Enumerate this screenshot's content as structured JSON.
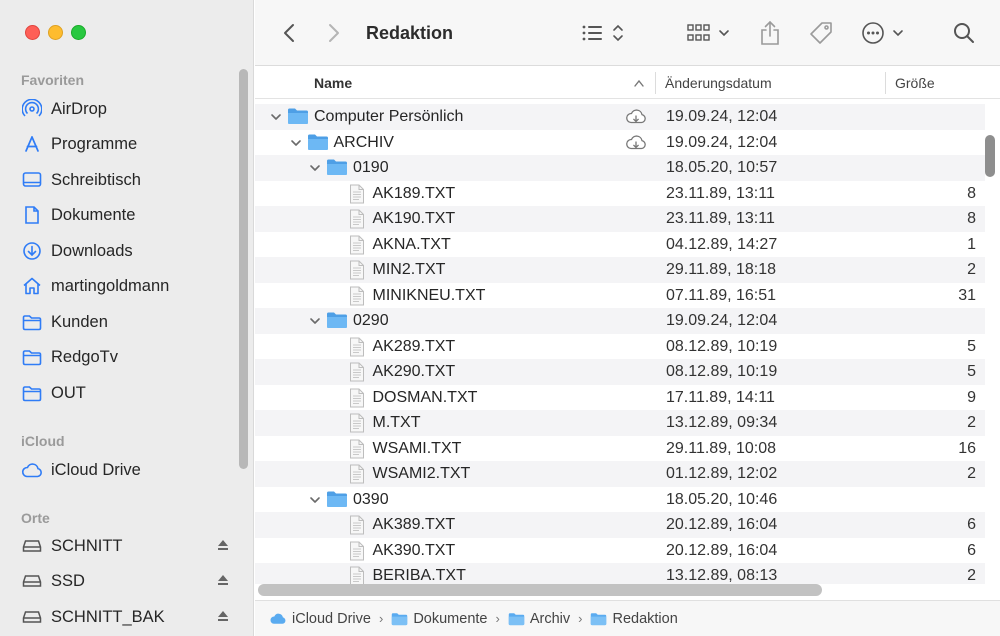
{
  "sidebar": {
    "sections": [
      {
        "label": "Favoriten",
        "items": [
          {
            "label": "AirDrop",
            "icon": "airdrop-icon"
          },
          {
            "label": "Programme",
            "icon": "applications-icon"
          },
          {
            "label": "Schreibtisch",
            "icon": "desktop-icon"
          },
          {
            "label": "Dokumente",
            "icon": "document-icon"
          },
          {
            "label": "Downloads",
            "icon": "downloads-icon"
          },
          {
            "label": "martingoldmann",
            "icon": "home-icon"
          },
          {
            "label": "Kunden",
            "icon": "folder-icon"
          },
          {
            "label": "RedgoTv",
            "icon": "folder-icon"
          },
          {
            "label": "OUT",
            "icon": "folder-icon"
          }
        ]
      },
      {
        "label": "iCloud",
        "items": [
          {
            "label": "iCloud Drive",
            "icon": "cloud-icon"
          }
        ]
      },
      {
        "label": "Orte",
        "items": [
          {
            "label": "SCHNITT",
            "icon": "disk-icon"
          },
          {
            "label": "SSD",
            "icon": "disk-icon"
          },
          {
            "label": "SCHNITT_BAK",
            "icon": "disk-icon"
          }
        ]
      }
    ]
  },
  "toolbar": {
    "title": "Redaktion"
  },
  "columns": {
    "name": "Name",
    "date": "Änderungsdatum",
    "size": "Größe"
  },
  "rows": [
    {
      "name": "Computer Persönlich",
      "date": "19.09.24, 12:04",
      "size": "",
      "level": 0,
      "type": "folder",
      "cloud": true
    },
    {
      "name": "ARCHIV",
      "date": "19.09.24, 12:04",
      "size": "",
      "level": 1,
      "type": "folder",
      "cloud": true
    },
    {
      "name": "0190",
      "date": "18.05.20, 10:57",
      "size": "",
      "level": 2,
      "type": "folder",
      "cloud": false
    },
    {
      "name": "AK189.TXT",
      "date": "23.11.89, 13:11",
      "size": "8",
      "level": 3,
      "type": "file"
    },
    {
      "name": "AK190.TXT",
      "date": "23.11.89, 13:11",
      "size": "8",
      "level": 3,
      "type": "file"
    },
    {
      "name": "AKNA.TXT",
      "date": "04.12.89, 14:27",
      "size": "1",
      "level": 3,
      "type": "file"
    },
    {
      "name": "MIN2.TXT",
      "date": "29.11.89, 18:18",
      "size": "2",
      "level": 3,
      "type": "file"
    },
    {
      "name": "MINIKNEU.TXT",
      "date": "07.11.89, 16:51",
      "size": "31",
      "level": 3,
      "type": "file"
    },
    {
      "name": "0290",
      "date": "19.09.24, 12:04",
      "size": "",
      "level": 2,
      "type": "folder",
      "cloud": false
    },
    {
      "name": "AK289.TXT",
      "date": "08.12.89, 10:19",
      "size": "5",
      "level": 3,
      "type": "file"
    },
    {
      "name": "AK290.TXT",
      "date": "08.12.89, 10:19",
      "size": "5",
      "level": 3,
      "type": "file"
    },
    {
      "name": "DOSMAN.TXT",
      "date": "17.11.89, 14:11",
      "size": "9",
      "level": 3,
      "type": "file"
    },
    {
      "name": "M.TXT",
      "date": "13.12.89, 09:34",
      "size": "2",
      "level": 3,
      "type": "file"
    },
    {
      "name": "WSAMI.TXT",
      "date": "29.11.89, 10:08",
      "size": "16",
      "level": 3,
      "type": "file"
    },
    {
      "name": "WSAMI2.TXT",
      "date": "01.12.89, 12:02",
      "size": "2",
      "level": 3,
      "type": "file"
    },
    {
      "name": "0390",
      "date": "18.05.20, 10:46",
      "size": "",
      "level": 2,
      "type": "folder",
      "cloud": false
    },
    {
      "name": "AK389.TXT",
      "date": "20.12.89, 16:04",
      "size": "6",
      "level": 3,
      "type": "file"
    },
    {
      "name": "AK390.TXT",
      "date": "20.12.89, 16:04",
      "size": "6",
      "level": 3,
      "type": "file"
    },
    {
      "name": "BERIBA.TXT",
      "date": "13.12.89, 08:13",
      "size": "2",
      "level": 3,
      "type": "file"
    }
  ],
  "pathbar": [
    "iCloud Drive",
    "Dokumente",
    "Archiv",
    "Redaktion"
  ],
  "colors": {
    "accent": "#2f7cf6",
    "folder": "#5aabf0",
    "sidebar_bg": "#ececec",
    "row_alt": "#f4f4f6"
  }
}
